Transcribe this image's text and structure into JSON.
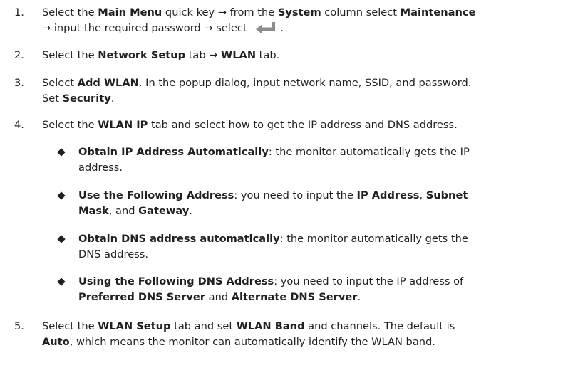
{
  "steps": [
    {
      "number": "1.",
      "lines": [
        [
          "Select the ",
          "Main Menu",
          " quick key → from the ",
          "System",
          " column select ",
          "Maintenance"
        ],
        [
          "→ input the required password → select ",
          "",
          "."
        ]
      ]
    },
    {
      "number": "2.",
      "lines": [
        [
          "Select the ",
          "Network Setup",
          " tab → ",
          "WLAN",
          " tab."
        ]
      ]
    },
    {
      "number": "3.",
      "lines": [
        [
          "Select ",
          "Add WLAN",
          ". In the popup dialog, input network name, SSID, and password."
        ],
        [
          "Set ",
          "Security",
          "."
        ]
      ]
    },
    {
      "number": "4.",
      "lines": [
        [
          "Select the ",
          "WLAN IP",
          " tab and select how to get the IP address and DNS address."
        ]
      ]
    },
    {
      "number": "5.",
      "lines": [
        [
          "Select the ",
          "WLAN Setup",
          " tab and set ",
          "WLAN Band",
          " and channels. The default is"
        ],
        [
          "",
          "Auto",
          ", which means the monitor can automatically identify the WLAN band."
        ]
      ]
    }
  ],
  "bullets": [
    {
      "lines": [
        [
          "Obtain IP Address Automatically",
          ": the monitor automatically gets the IP"
        ],
        [
          "address."
        ]
      ]
    },
    {
      "lines": [
        [
          "Use the Following Address",
          ": you need to input the ",
          "IP Address",
          ", ",
          "Subnet"
        ],
        [
          "Mask",
          ", and ",
          "Gateway",
          "."
        ]
      ]
    },
    {
      "lines": [
        [
          "Obtain DNS address automatically",
          ": the monitor automatically gets the"
        ],
        [
          "DNS address."
        ]
      ]
    },
    {
      "lines": [
        [
          "Using the Following DNS Address",
          ": you need to input the IP address of"
        ],
        [
          "Preferred DNS Server",
          " and ",
          "Alternate DNS Server",
          "."
        ]
      ]
    }
  ],
  "icons": {
    "enter": "enter-key-icon"
  },
  "colors": {
    "text": "#231f20",
    "icon": "#8a8d90"
  }
}
